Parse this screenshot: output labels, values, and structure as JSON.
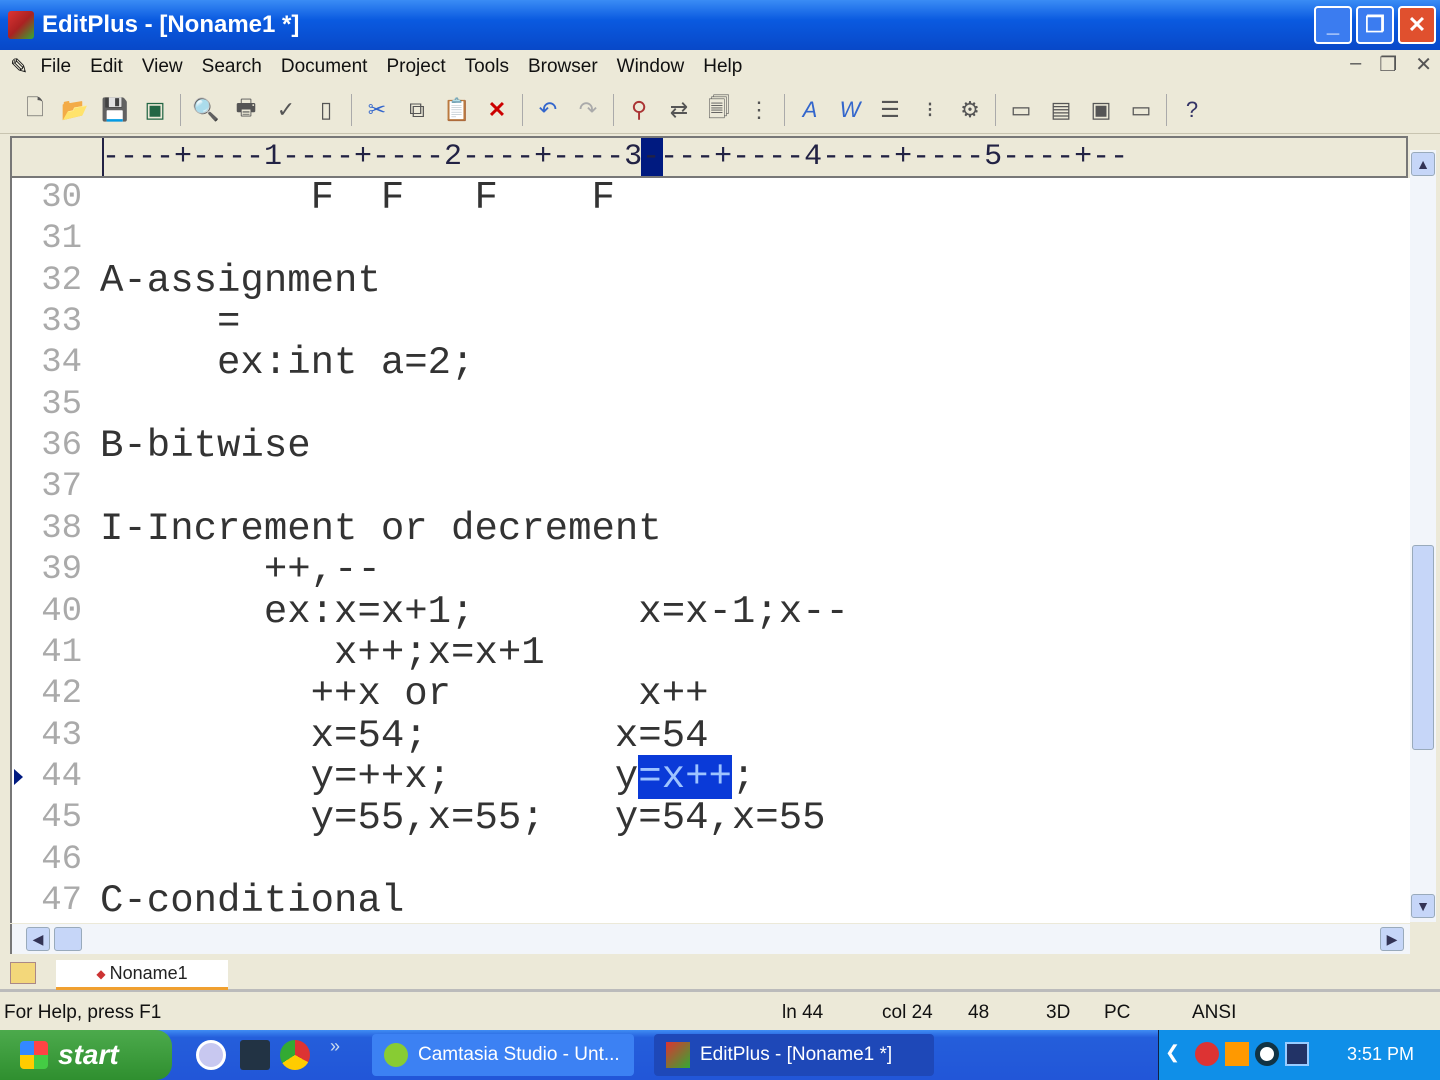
{
  "window": {
    "title": "EditPlus - [Noname1 *]"
  },
  "menu": [
    "File",
    "Edit",
    "View",
    "Search",
    "Document",
    "Project",
    "Tools",
    "Browser",
    "Window",
    "Help"
  ],
  "ruler": "----+----1----+----2----+----3----+----4----+----5----+--",
  "lines": [
    {
      "n": "30",
      "parts": [
        "         F  F   F    F"
      ]
    },
    {
      "n": "31",
      "parts": [
        ""
      ]
    },
    {
      "n": "32",
      "parts": [
        "A-assignment"
      ]
    },
    {
      "n": "33",
      "parts": [
        "     ="
      ]
    },
    {
      "n": "34",
      "parts": [
        "     ex:int a=2;"
      ]
    },
    {
      "n": "35",
      "parts": [
        ""
      ]
    },
    {
      "n": "36",
      "parts": [
        "B-bitwise"
      ]
    },
    {
      "n": "37",
      "parts": [
        ""
      ]
    },
    {
      "n": "38",
      "parts": [
        "I-Increment or decrement"
      ]
    },
    {
      "n": "39",
      "parts": [
        "       ++,--"
      ]
    },
    {
      "n": "40",
      "parts": [
        "       ex:x=x+1;       x=x-1;x--"
      ]
    },
    {
      "n": "41",
      "parts": [
        "          x++;x=x+1"
      ]
    },
    {
      "n": "42",
      "parts": [
        "         ++x or        x++"
      ]
    },
    {
      "n": "43",
      "parts": [
        "         x=54;        x=54"
      ]
    },
    {
      "n": "44",
      "parts": [
        "         y=++x;       y",
        "=x++",
        ";"
      ]
    },
    {
      "n": "45",
      "parts": [
        "         y=55,x=55;   y=54,x=55"
      ]
    },
    {
      "n": "46",
      "parts": [
        ""
      ]
    },
    {
      "n": "47",
      "parts": [
        "C-conditional"
      ]
    }
  ],
  "tab": {
    "label": "Noname1"
  },
  "status": {
    "help": "For Help, press F1",
    "line": "ln 44",
    "col": "col 24",
    "chars": "48",
    "mode": "3D",
    "format": "PC",
    "encoding": "ANSI"
  },
  "taskbar": {
    "start": "start",
    "tasks": [
      "Camtasia Studio - Unt...",
      "EditPlus - [Noname1 *]"
    ],
    "clock": "3:51 PM"
  }
}
